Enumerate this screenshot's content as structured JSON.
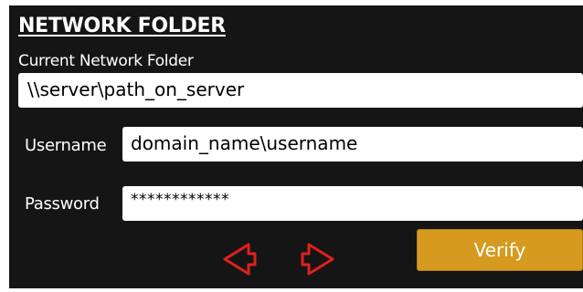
{
  "screen": {
    "title": "NETWORK FOLDER",
    "folder_label": "Current Network Folder",
    "folder_value": "\\\\server\\path_on_server",
    "username_label": "Username",
    "username_value": "domain_name\\username",
    "password_label": "Password",
    "password_value": "************",
    "verify_label": "Verify"
  },
  "icons": {
    "back": "back-arrow-icon",
    "forward": "forward-arrow-icon"
  },
  "colors": {
    "background": "#151515",
    "accent": "#d59a1f",
    "nav_arrows": "#e0211c",
    "text": "#ffffff",
    "field": "#ffffff"
  }
}
